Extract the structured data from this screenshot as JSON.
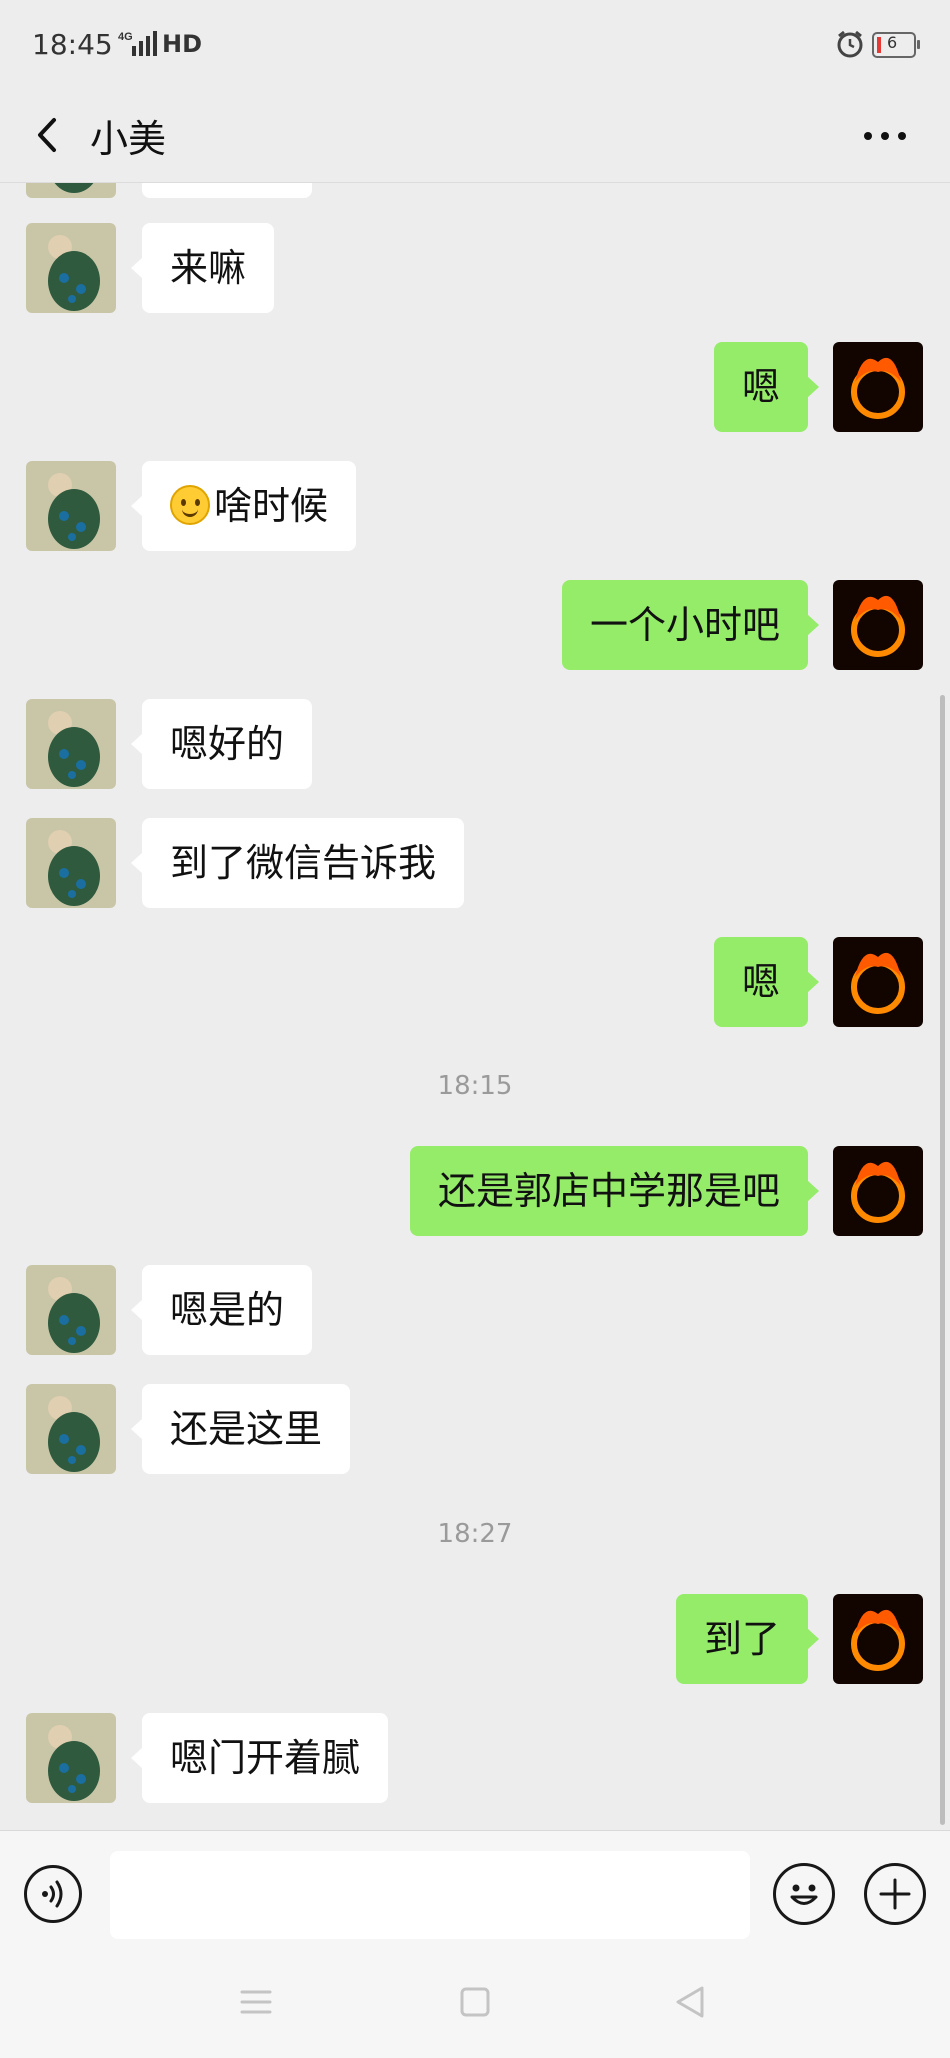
{
  "status_bar": {
    "time": "18:45",
    "network": "4G",
    "hd": "HD",
    "battery": "6"
  },
  "header": {
    "title": "小美"
  },
  "icons": {
    "back": "chevron-left-icon",
    "more": "more-horizontal-icon",
    "voice": "voice-icon",
    "emoji": "smile-icon",
    "plus": "plus-icon",
    "avatar_contact": "peacock-avatar",
    "avatar_self": "fire-ring-avatar"
  },
  "colors": {
    "background": "#ededed",
    "bubble_self": "#95ec69",
    "bubble_other": "#ffffff",
    "timestamp": "#9a9a9a"
  },
  "messages": [
    {
      "side": "left",
      "text": "来嘛"
    },
    {
      "side": "right",
      "text": "嗯"
    },
    {
      "side": "left",
      "text": "啥时候",
      "emoji": "slight-smile-emoji"
    },
    {
      "side": "right",
      "text": "一个小时吧"
    },
    {
      "side": "left",
      "text": "嗯好的"
    },
    {
      "side": "left",
      "text": "到了微信告诉我"
    },
    {
      "side": "right",
      "text": "嗯"
    },
    {
      "type": "time",
      "text": "18:15"
    },
    {
      "side": "right",
      "text": "还是郭店中学那是吧"
    },
    {
      "side": "left",
      "text": "嗯是的"
    },
    {
      "side": "left",
      "text": "还是这里"
    },
    {
      "type": "time",
      "text": "18:27"
    },
    {
      "side": "right",
      "text": "到了"
    },
    {
      "side": "left",
      "text": "嗯门开着腻"
    }
  ],
  "input": {
    "placeholder": "",
    "value": ""
  },
  "nav": [
    "menu-icon",
    "home-square-icon",
    "back-triangle-icon"
  ]
}
